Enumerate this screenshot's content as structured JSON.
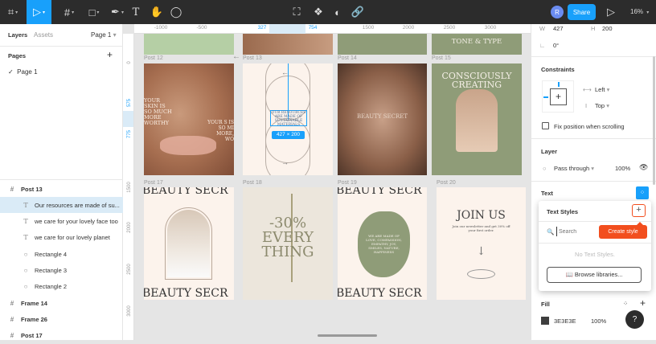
{
  "toolbar": {
    "tools": [
      "figma-menu",
      "move",
      "frame",
      "shape",
      "pen",
      "text",
      "hand",
      "comment"
    ],
    "center_tools": [
      "crop",
      "component",
      "mask",
      "link"
    ],
    "avatar": "R",
    "share": "Share",
    "zoom": "16%",
    "accent": "#18a0fb"
  },
  "left_panel": {
    "tabs": [
      "Layers",
      "Assets"
    ],
    "page_select": "Page 1",
    "pages_title": "Pages",
    "pages": [
      "Page 1"
    ],
    "layers": [
      {
        "icon": "frame",
        "label": "Post 13",
        "indent": 0
      },
      {
        "icon": "text",
        "label": "Our resources are made of su...",
        "indent": 1,
        "selected": true
      },
      {
        "icon": "text",
        "label": "we care for your lovely face too",
        "indent": 1
      },
      {
        "icon": "text",
        "label": "we care for our lovely planet",
        "indent": 1
      },
      {
        "icon": "ellipse",
        "label": "Rectangle 4",
        "indent": 1
      },
      {
        "icon": "ellipse",
        "label": "Rectangle 3",
        "indent": 1
      },
      {
        "icon": "ellipse",
        "label": "Rectangle 2",
        "indent": 1
      },
      {
        "icon": "frame",
        "label": "Frame 14",
        "indent": 0
      },
      {
        "icon": "frame",
        "label": "Frame 26",
        "indent": 0
      },
      {
        "icon": "frame",
        "label": "Post 17",
        "indent": 0
      }
    ]
  },
  "rulers": {
    "top": [
      "-1000",
      "-500",
      "327",
      "754",
      "1500",
      "2000",
      "2500",
      "3000"
    ],
    "left": [
      "0",
      "575",
      "775",
      "1500",
      "2000",
      "2500",
      "3000"
    ]
  },
  "canvas": {
    "frames": [
      {
        "label": "Post 12"
      },
      {
        "label": "Post 13"
      },
      {
        "label": "Post 14"
      },
      {
        "label": "Post 15"
      },
      {
        "label": "Post 17"
      },
      {
        "label": "Post 18"
      },
      {
        "label": "Post 19"
      },
      {
        "label": "Post 20"
      }
    ],
    "post12_text": [
      "YOUR SKIN IS SO MUCH MORE WORTHY",
      "YOUR S IS SO MI MORE, WO"
    ],
    "post13_selected_text": "OUR RESOURCES ARE MADE OF SUSTAINABLE MATERIALS",
    "size_badge": "427 × 200",
    "post14_text": "BEAUTY SECRET",
    "post15_top_text": "TONE & TYPE",
    "post15_text": "CONSCIOUSLY CREATING",
    "post17_text": "BEAUTY SECR",
    "post18_text": [
      "-30%",
      "EVERY",
      "THING"
    ],
    "post19_text": "WE ARE MADE OF LOVE, COMPASSION, EMPATHY, JOY, SMILES, NATURE, HAPPINESS",
    "post20": {
      "title": "JOIN US",
      "body": "Join our newsletter and get 30% off your first order."
    }
  },
  "right_panel": {
    "w_label": "W",
    "w": "427",
    "h_label": "H",
    "h": "200",
    "rotation": "0°",
    "constraints": {
      "title": "Constraints",
      "horizontal": "Left",
      "vertical": "Top",
      "fix_label": "Fix position when scrolling",
      "fix_checked": false
    },
    "layer": {
      "title": "Layer",
      "blend": "Pass through",
      "opacity": "100%"
    },
    "text": {
      "title": "Text"
    },
    "text_styles": {
      "title": "Text Styles",
      "search_placeholder": "Search",
      "tooltip": "Create style",
      "empty": "No Text Styles.",
      "browse": "Browse libraries...",
      "tooltip_color": "#f24e1e"
    },
    "fill": {
      "title": "Fill",
      "color": "3E3E3E",
      "hex": "#3e3e3e",
      "opacity": "100%"
    },
    "help": "?"
  }
}
